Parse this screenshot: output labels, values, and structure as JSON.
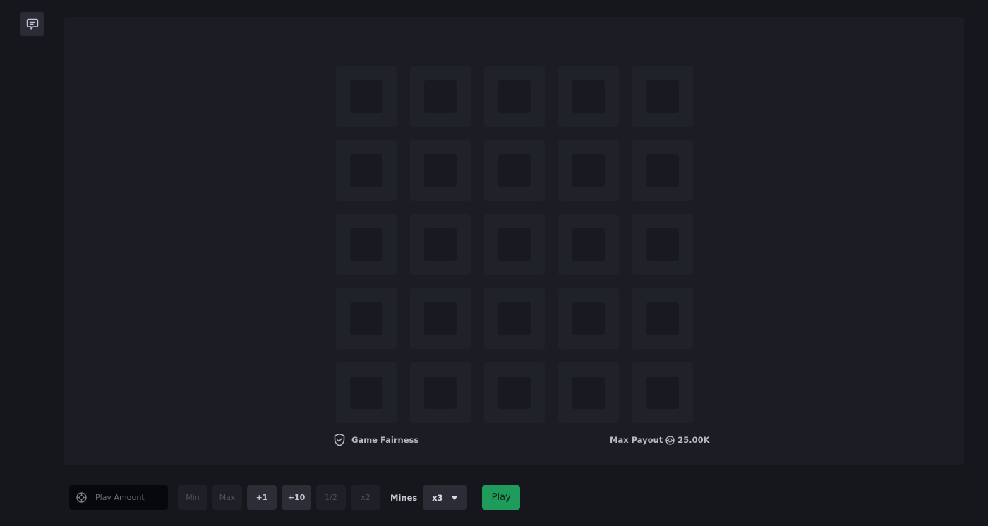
{
  "chat": {
    "icon": "chat-icon"
  },
  "board": {
    "rows": 5,
    "cols": 5
  },
  "footer": {
    "fairness_label": "Game Fairness",
    "fairness_icon": "shield-check-icon",
    "max_payout_label": "Max Payout",
    "max_payout_icon": "coin-icon",
    "max_payout_value": "25.00K"
  },
  "controls": {
    "amount_placeholder": "Play Amount",
    "amount_icon": "coin-icon",
    "min_label": "Min",
    "max_label": "Max",
    "plus1_label": "+1",
    "plus10_label": "+10",
    "half_label": "1/2",
    "double_label": "x2",
    "mines_label": "Mines",
    "mines_value": "x3",
    "mines_dropdown_icon": "caret-down-icon",
    "play_label": "Play"
  },
  "colors": {
    "background": "#16171c",
    "panel": "#1c1d24",
    "tile": "#20222a",
    "play_button": "#1f9b5c"
  }
}
